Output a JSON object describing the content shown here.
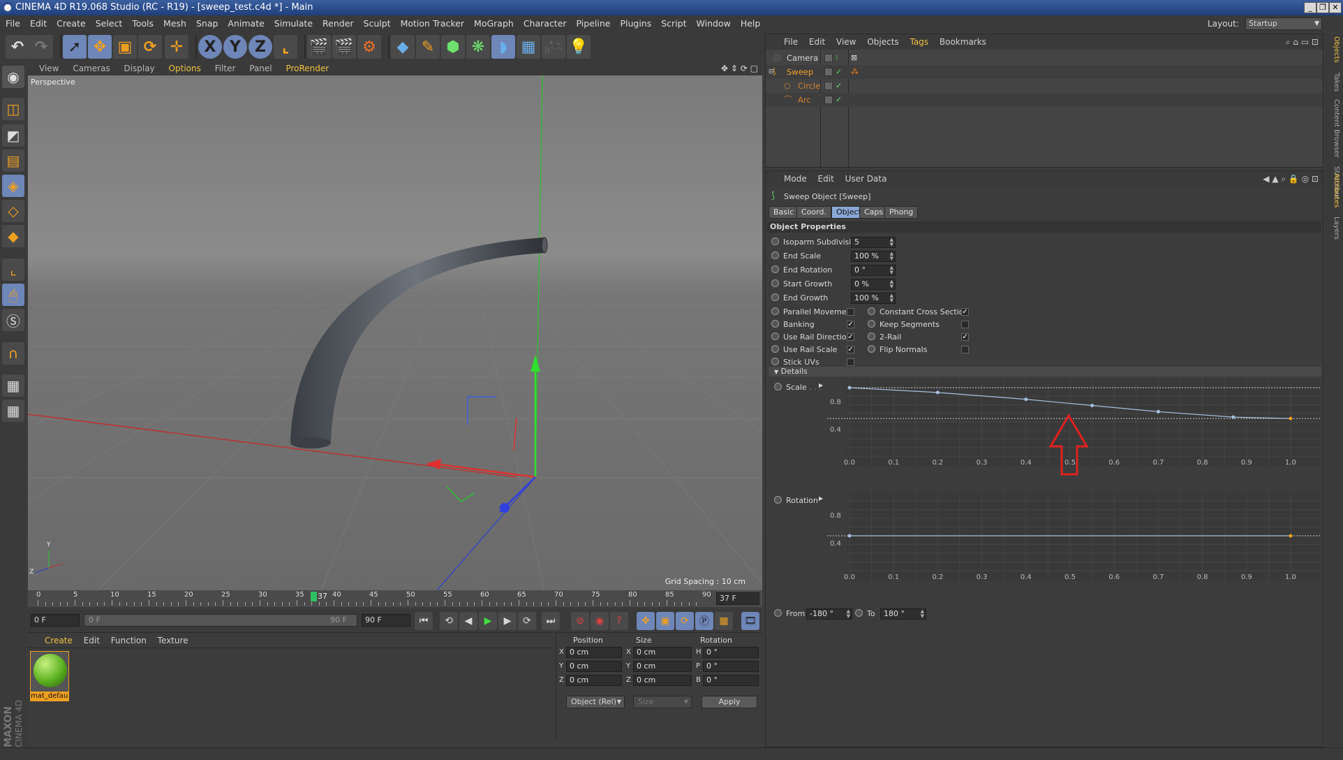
{
  "window": {
    "title": "CINEMA 4D R19.068 Studio (RC - R19) - [sweep_test.c4d *] - Main",
    "layout_label": "Layout:",
    "layout_value": "Startup"
  },
  "menu": [
    "File",
    "Edit",
    "Create",
    "Select",
    "Tools",
    "Mesh",
    "Snap",
    "Animate",
    "Simulate",
    "Render",
    "Sculpt",
    "Motion Tracker",
    "MoGraph",
    "Character",
    "Pipeline",
    "Plugins",
    "Script",
    "Window",
    "Help"
  ],
  "toolbar": {
    "axis_x": "X",
    "axis_y": "Y",
    "axis_z": "Z"
  },
  "viewport": {
    "menu": [
      "View",
      "Cameras",
      "Display",
      "Options",
      "Filter",
      "Panel",
      "ProRender"
    ],
    "label": "Perspective",
    "grid_spacing": "Grid Spacing : 10 cm",
    "axis_y": "Y",
    "axis_z": "Z",
    "axis_x": "X"
  },
  "timeline": {
    "ticks": [
      "0",
      "5",
      "10",
      "15",
      "20",
      "25",
      "30",
      "35",
      "40",
      "45",
      "50",
      "55",
      "60",
      "65",
      "70",
      "75",
      "80",
      "85",
      "90"
    ],
    "current_marker": "37",
    "current_frame": "37 F",
    "start_frame": "0 F",
    "range_start": "0 F",
    "range_end": "90 F",
    "end_frame": "90 F"
  },
  "material_manager": {
    "menu": [
      "Create",
      "Edit",
      "Function",
      "Texture"
    ],
    "material_name": "mat_default"
  },
  "coord_manager": {
    "headers": [
      "Position",
      "Size",
      "Rotation"
    ],
    "rows": [
      {
        "pl": "X",
        "pv": "0 cm",
        "sl": "X",
        "sv": "0 cm",
        "rl": "H",
        "rv": "0 °"
      },
      {
        "pl": "Y",
        "pv": "0 cm",
        "sl": "Y",
        "sv": "0 cm",
        "rl": "P",
        "rv": "0 °"
      },
      {
        "pl": "Z",
        "pv": "0 cm",
        "sl": "Z",
        "sv": "0 cm",
        "rl": "B",
        "rv": "0 °"
      }
    ],
    "mode": "Object (Rel)",
    "size_mode": "Size",
    "apply": "Apply"
  },
  "object_manager": {
    "menu": [
      "File",
      "Edit",
      "View",
      "Objects",
      "Tags",
      "Bookmarks"
    ],
    "objects": [
      {
        "name": "Camera",
        "color": "#d8d8d8"
      },
      {
        "name": "Sweep",
        "color": "#f0a030"
      },
      {
        "name": "Circle",
        "color": "#d08030"
      },
      {
        "name": "Arc",
        "color": "#d08030"
      }
    ]
  },
  "attributes": {
    "menu": [
      "Mode",
      "Edit",
      "User Data"
    ],
    "object_title": "Sweep Object [Sweep]",
    "tabs": [
      "Basic",
      "Coord.",
      "Object",
      "Caps",
      "Phong"
    ],
    "active_tab": "Object",
    "section": "Object Properties",
    "fields": [
      {
        "label": "Isoparm Subdivision",
        "value": "5"
      },
      {
        "label": "End Scale",
        "value": "100 %"
      },
      {
        "label": "End Rotation",
        "value": "0 °"
      },
      {
        "label": "Start Growth",
        "value": "0 %"
      },
      {
        "label": "End Growth",
        "value": "100 %"
      }
    ],
    "checks_left": [
      {
        "label": "Parallel Movement",
        "checked": false
      },
      {
        "label": "Banking",
        "checked": true
      },
      {
        "label": "Use Rail Direction",
        "checked": true
      },
      {
        "label": "Use Rail Scale",
        "checked": true
      },
      {
        "label": "Stick UVs",
        "checked": false
      }
    ],
    "checks_right": [
      {
        "label": "Constant Cross Section",
        "checked": true
      },
      {
        "label": "Keep Segments",
        "checked": false
      },
      {
        "label": "2-Rail",
        "checked": true
      },
      {
        "label": "Flip Normals",
        "checked": false
      }
    ],
    "details_label": "Details",
    "scale_label": "Scale",
    "rotation_label": "Rotation",
    "graph_x_ticks": [
      "0.0",
      "0.1",
      "0.2",
      "0.3",
      "0.4",
      "0.5",
      "0.6",
      "0.7",
      "0.8",
      "0.9",
      "1.0"
    ],
    "graph_y_ticks": [
      "0.8",
      "0.4"
    ],
    "from_label": "From",
    "from_value": "-180 °",
    "to_label": "To",
    "to_value": "180 °"
  },
  "right_tabs": [
    "Objects",
    "Takes",
    "Content Browser",
    "Structure",
    "Attributes",
    "Layers"
  ],
  "brand": {
    "maxon": "MAXON",
    "product": "CINEMA 4D"
  }
}
